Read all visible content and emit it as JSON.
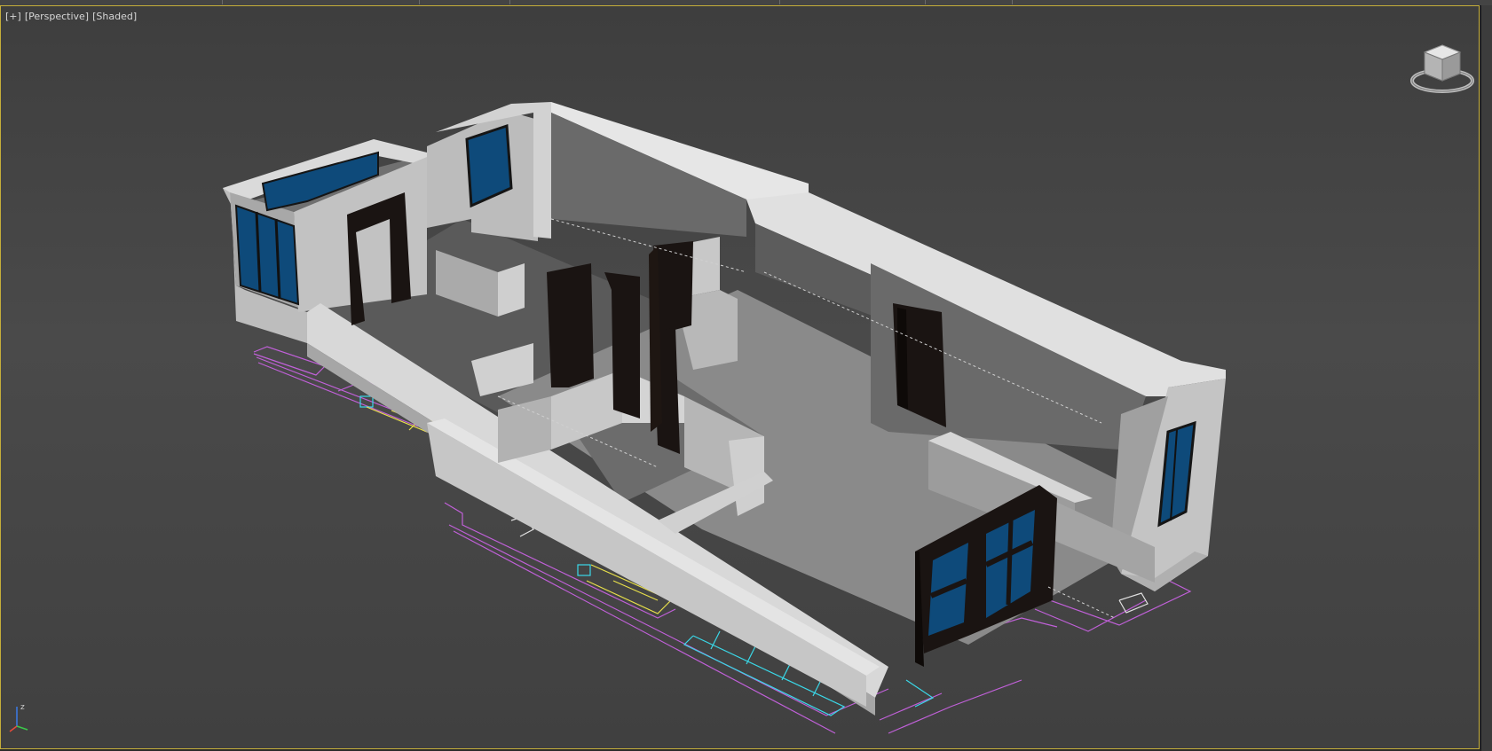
{
  "viewport": {
    "menu_label": "[+]",
    "view_label": "[Perspective]",
    "shading_label": "[Shaded]",
    "active_border_color": "#c5ae3a"
  },
  "viewcube": {
    "icon": "viewcube-icon"
  },
  "axis": {
    "z_label": "z",
    "icon": "axis-tripod-icon"
  },
  "colors": {
    "background": "#454545",
    "wall": "#c8c8c8",
    "floor": "#8a8a8a",
    "door": "#1a1412",
    "glass": "#0e4a7a",
    "cad_magenta": "#c060d8",
    "cad_yellow": "#e8e04a",
    "cad_cyan": "#3ad8e8"
  }
}
